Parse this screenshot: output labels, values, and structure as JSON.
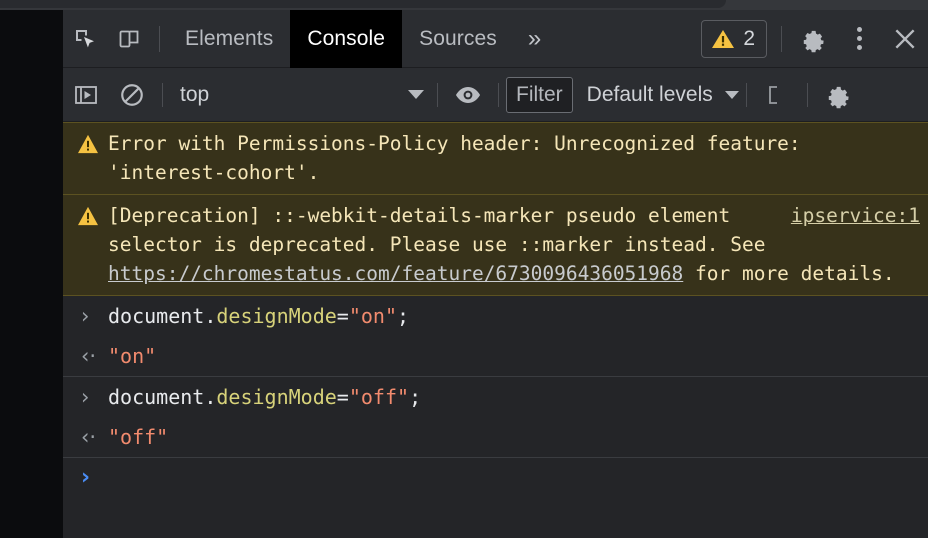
{
  "tabbar": {
    "icons": [
      {
        "name": "inspect-element-icon",
        "label": "Inspect element"
      },
      {
        "name": "device-toolbar-icon",
        "label": "Toggle device toolbar"
      }
    ],
    "tabs": [
      {
        "id": "elements",
        "label": "Elements",
        "active": false
      },
      {
        "id": "console",
        "label": "Console",
        "active": true
      },
      {
        "id": "sources",
        "label": "Sources",
        "active": false
      }
    ],
    "more_label": "»",
    "error_badge": {
      "icon": "warning-triangle-icon",
      "count": "2"
    },
    "settings_label": "gear-icon",
    "menu_label": "kebab-menu-icon",
    "close_label": "×"
  },
  "filterbar": {
    "execute_icon": "execute-step-icon",
    "clear_icon": "clear-console-icon",
    "context": {
      "value": "top",
      "caret": "▼"
    },
    "eye_icon": "eye-icon",
    "filter": {
      "placeholder": "Filter",
      "value": ""
    },
    "levels": {
      "value": "Default levels",
      "caret": "▼"
    },
    "sidebar_icon": "console-sidebar-icon",
    "settings_icon": "gear-icon"
  },
  "console": {
    "messages": [
      {
        "type": "warning",
        "icon": "warning-triangle-icon",
        "text": "Error with Permissions-Policy header: Unrecognized feature: 'interest-cohort'.",
        "source": ""
      },
      {
        "type": "warning",
        "icon": "warning-triangle-icon",
        "source": "ipservice:1",
        "parts": [
          {
            "kind": "text",
            "value": "[Deprecation] ::-webkit-details-marker pseudo element selector is deprecated. Please use ::marker instead. See "
          },
          {
            "kind": "link",
            "value": "https://chromestatus.com/feature/6730096436051968"
          },
          {
            "kind": "text",
            "value": " for more details."
          }
        ]
      }
    ],
    "entries": [
      {
        "input": {
          "chevron": "›",
          "tokens": [
            {
              "cls": "plain",
              "text": "document."
            },
            {
              "cls": "prop",
              "text": "designMode"
            },
            {
              "cls": "plain",
              "text": "="
            },
            {
              "cls": "str",
              "text": "\"on\""
            },
            {
              "cls": "plain",
              "text": ";"
            }
          ]
        },
        "output": {
          "chevron": "‹·",
          "value": "\"on\""
        }
      },
      {
        "input": {
          "chevron": "›",
          "tokens": [
            {
              "cls": "plain",
              "text": "document."
            },
            {
              "cls": "prop",
              "text": "designMode"
            },
            {
              "cls": "plain",
              "text": "="
            },
            {
              "cls": "str",
              "text": "\"off\""
            },
            {
              "cls": "plain",
              "text": ";"
            }
          ]
        },
        "output": {
          "chevron": "‹·",
          "value": "\"off\""
        }
      }
    ],
    "prompt": {
      "chevron": "›",
      "value": ""
    }
  },
  "colors": {
    "panel_bg": "#242528",
    "toolbar_bg": "#2b2d31",
    "warning_bg": "#37321a",
    "warning_border": "#5c5221",
    "warning_text": "#f5e6b8",
    "accent_blue": "#4a8df5",
    "string_orange": "#f28b6e",
    "property_yellow": "#d7d27a",
    "warn_icon": "#f5c242"
  }
}
